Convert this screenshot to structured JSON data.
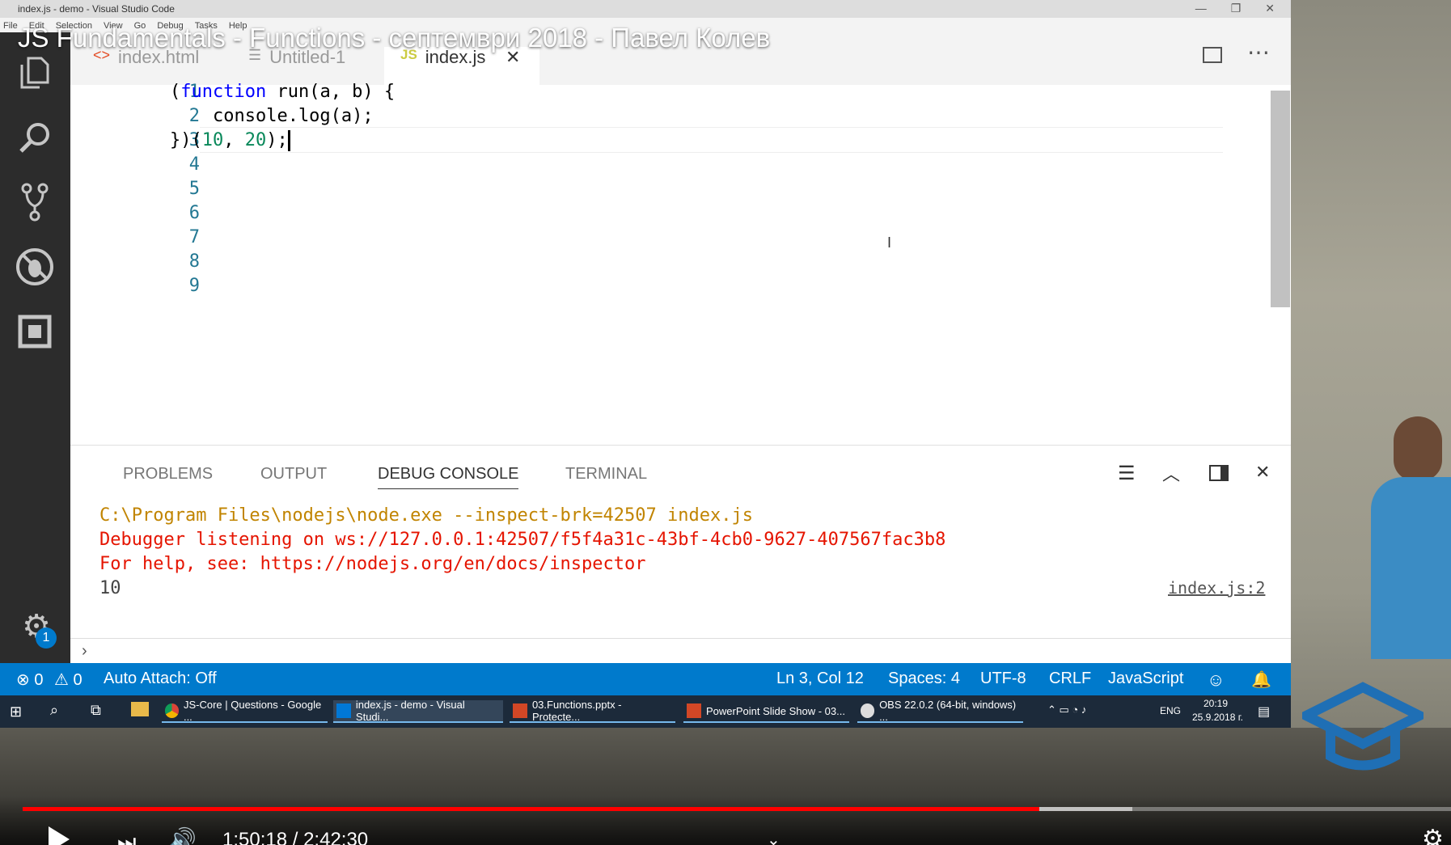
{
  "video": {
    "title": "JS Fundamentals - Functions - септември 2018 - Павел Колев",
    "time": "1:50:18 / 2:42:30",
    "progress": 0.7118,
    "buffered": 0.7768
  },
  "window": {
    "title": "index.js - demo - Visual Studio Code",
    "menu": [
      "File",
      "Edit",
      "Selection",
      "View",
      "Go",
      "Debug",
      "Tasks",
      "Help"
    ]
  },
  "tabs": [
    {
      "label": "index.html",
      "icon": "html-file-icon"
    },
    {
      "label": "Untitled-1",
      "icon": "text-file-icon"
    },
    {
      "label": "index.js",
      "icon": "js-file-icon",
      "badge": "JS"
    }
  ],
  "editor": {
    "line_numbers": [
      "1",
      "2",
      "3",
      "4",
      "5",
      "6",
      "7",
      "8",
      "9"
    ],
    "code": {
      "l1_a": "(",
      "l1_kw": "function",
      "l1_b": " run(a, b) {",
      "l2": "    console.log(a);",
      "l3_a": "})(",
      "l3_n1": "10",
      "l3_b": ", ",
      "l3_n2": "20",
      "l3_c": ");"
    }
  },
  "panel": {
    "tabs": [
      "PROBLEMS",
      "OUTPUT",
      "DEBUG CONSOLE",
      "TERMINAL"
    ],
    "lines": [
      "C:\\Program Files\\nodejs\\node.exe --inspect-brk=42507 index.js",
      "Debugger listening on ws://127.0.0.1:42507/f5f4a31c-43bf-4cb0-9627-407567fac3b8",
      "For help, see: https://nodejs.org/en/docs/inspector",
      "10"
    ],
    "source_link": "index.js:2",
    "colors": {
      "cmd": "#c18401",
      "error": "#e51400",
      "output": "#444444"
    }
  },
  "statusbar": {
    "errors": "0",
    "warnings": "0",
    "auto_attach": "Auto Attach: Off",
    "position": "Ln 3, Col 12",
    "spaces": "Spaces: 4",
    "encoding": "UTF-8",
    "eol": "CRLF",
    "language": "JavaScript",
    "settings_badge": "1"
  },
  "taskbar": {
    "items": [
      "JS-Core | Questions - Google ...",
      "index.js - demo - Visual Studi...",
      "03.Functions.pptx - Protecte...",
      "PowerPoint Slide Show - 03...",
      "OBS 22.0.2 (64-bit, windows) ..."
    ],
    "lang": "ENG",
    "clock_time": "20:19",
    "clock_date": "25.9.2018 г."
  },
  "colors": {
    "accent": "#007acc",
    "activity_bar": "#2c2c2c",
    "progress": "#ff0000"
  }
}
